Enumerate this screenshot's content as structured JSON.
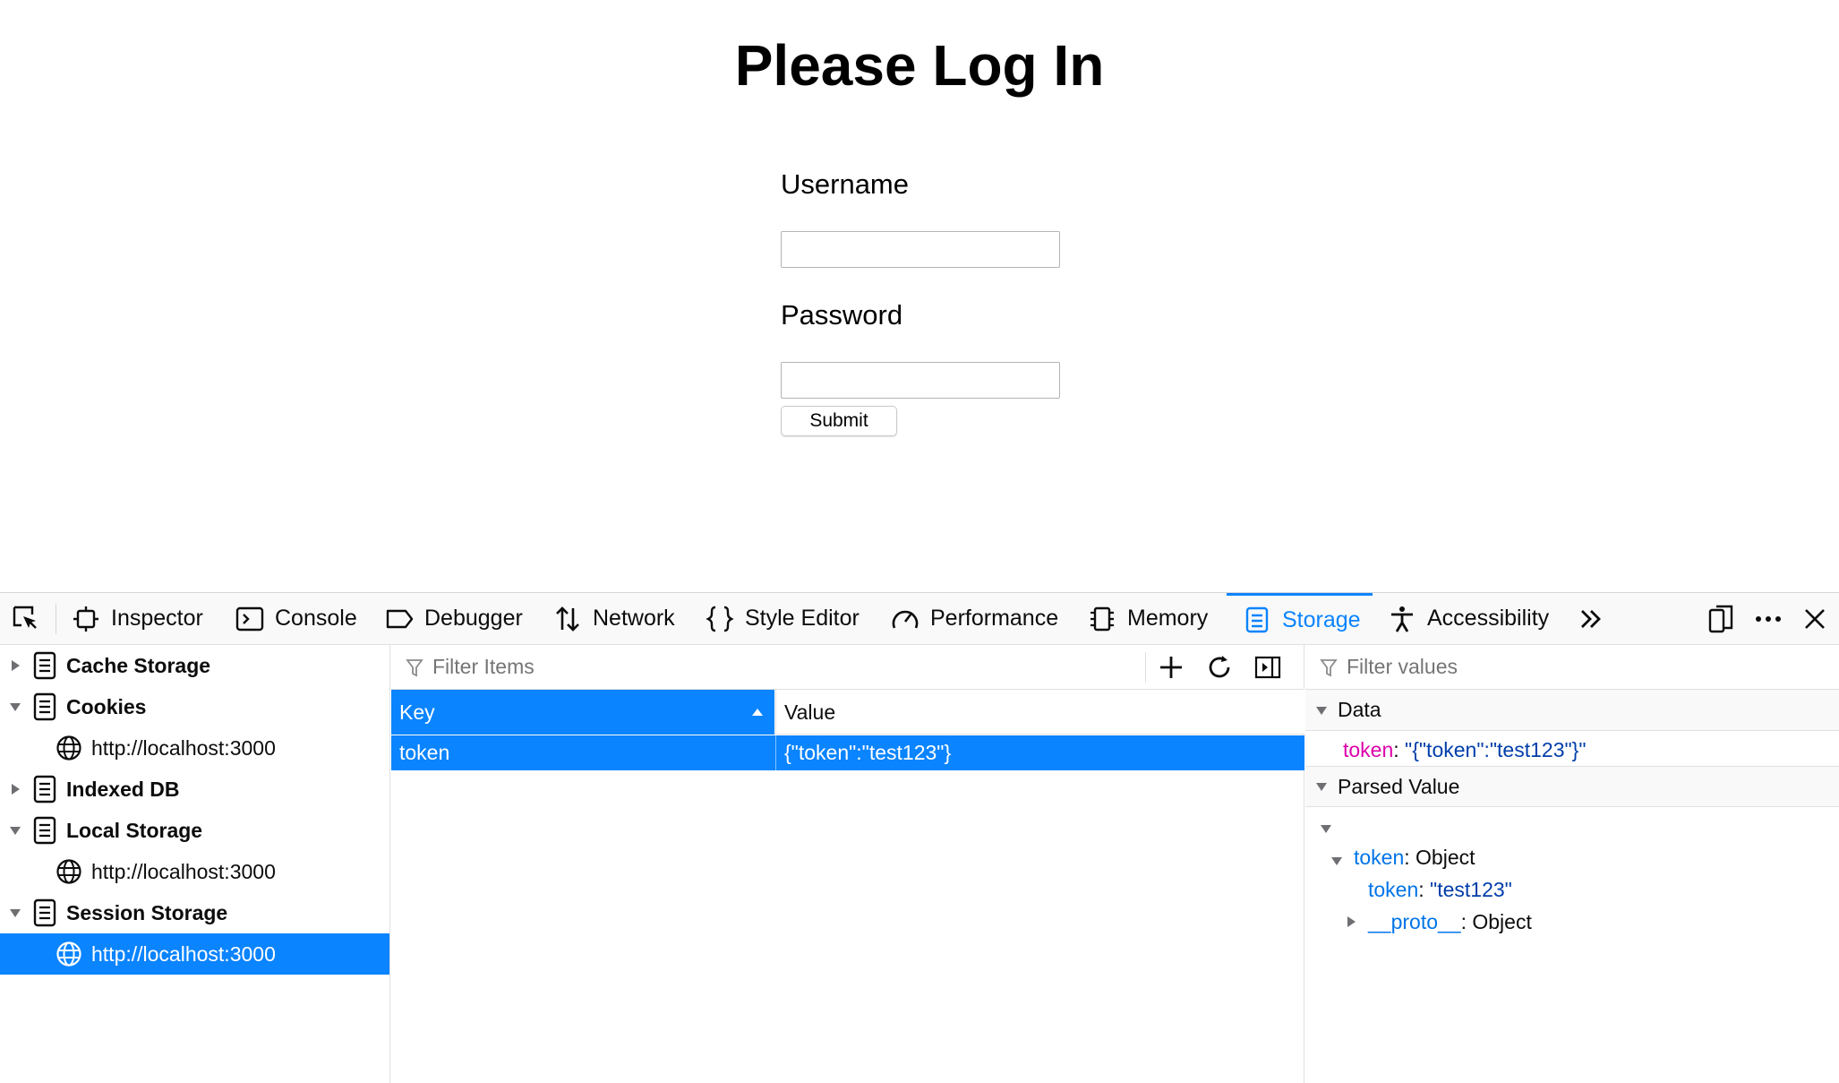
{
  "page": {
    "title": "Please Log In",
    "username_label": "Username",
    "username_value": "",
    "password_label": "Password",
    "password_value": "",
    "submit_label": "Submit"
  },
  "devtools": {
    "tools": [
      {
        "label": "Inspector",
        "icon": "inspector-icon"
      },
      {
        "label": "Console",
        "icon": "console-icon"
      },
      {
        "label": "Debugger",
        "icon": "debugger-icon"
      },
      {
        "label": "Network",
        "icon": "network-icon"
      },
      {
        "label": "Style Editor",
        "icon": "style-editor-icon"
      },
      {
        "label": "Performance",
        "icon": "performance-icon"
      },
      {
        "label": "Memory",
        "icon": "memory-icon"
      },
      {
        "label": "Storage",
        "icon": "storage-icon",
        "selected": true
      },
      {
        "label": "Accessibility",
        "icon": "accessibility-icon"
      }
    ],
    "tree": {
      "cache_storage": "Cache Storage",
      "cookies": "Cookies",
      "cookies_host": "http://localhost:3000",
      "indexed_db": "Indexed DB",
      "local_storage": "Local Storage",
      "local_storage_host": "http://localhost:3000",
      "session_storage": "Session Storage",
      "session_storage_host": "http://localhost:3000"
    },
    "table": {
      "filter_placeholder": "Filter Items",
      "columns": [
        "Key",
        "Value"
      ],
      "rows": [
        {
          "key": "token",
          "value": "{\"token\":\"test123\"}"
        }
      ]
    },
    "sidebar": {
      "filter_placeholder": "Filter values",
      "data_header": "Data",
      "data_key": "token",
      "data_value": "\"{\"token\":\"test123\"}\"",
      "parsed_header": "Parsed Value",
      "obj_key": "token",
      "obj_type": "Object",
      "inner_key": "token",
      "inner_value": "\"test123\"",
      "proto_key": "__proto__",
      "proto_type": "Object",
      "colon": ": "
    },
    "colors": {
      "accent": "#0a84ff",
      "key_pink": "#dd00a9",
      "key_blue": "#0074e8",
      "string_dark_blue": "#003eaa"
    }
  }
}
